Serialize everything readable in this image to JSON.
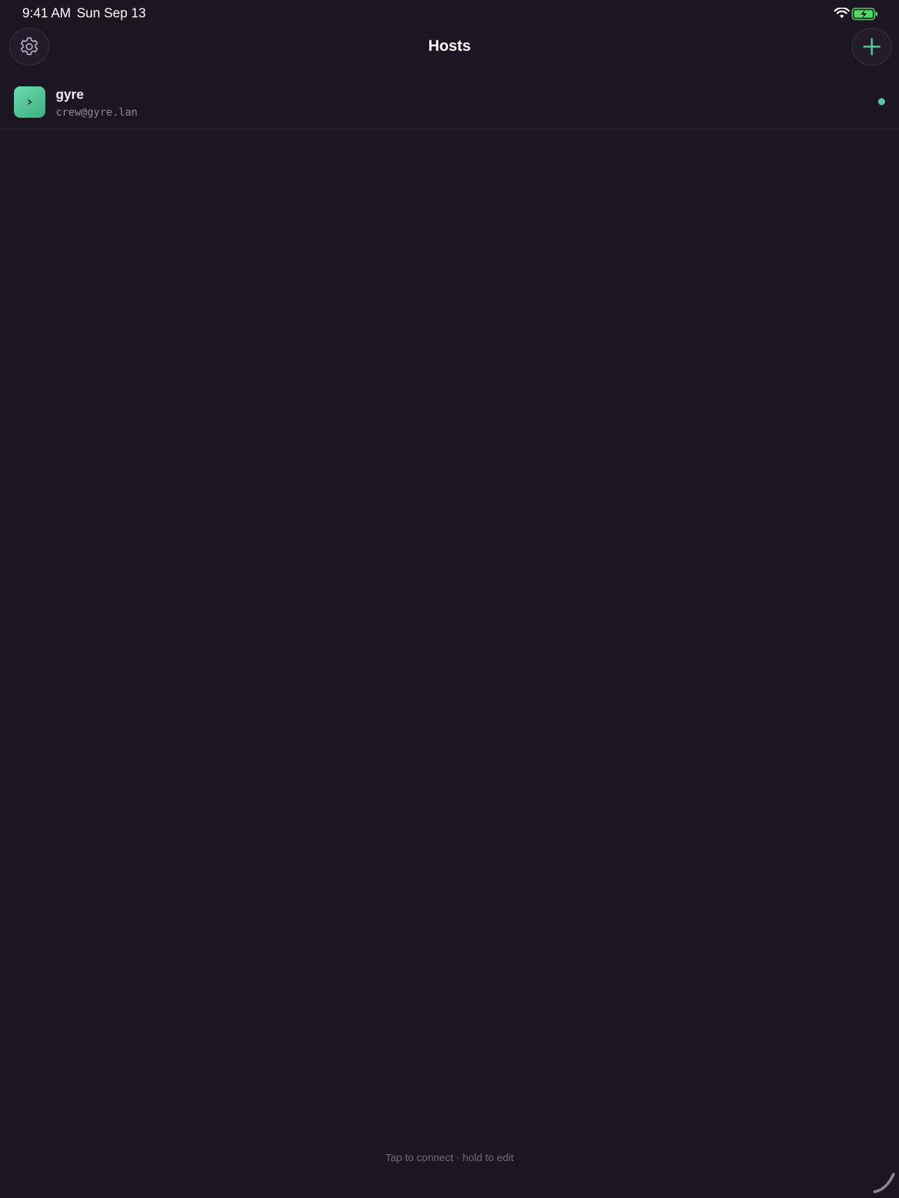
{
  "status_bar": {
    "time": "9:41 AM",
    "date": "Sun Sep 13",
    "icons": [
      "wifi-icon",
      "battery-charging-icon"
    ],
    "battery_color": "#4cd964"
  },
  "nav": {
    "title": "Hosts",
    "left_icon": "gear-icon",
    "right_icon": "plus-icon",
    "accent": "#55c99c"
  },
  "hosts": [
    {
      "name": "gyre",
      "address": "crew@gyre.lan",
      "avatar_glyph": "›",
      "status": "online",
      "status_color": "#55c99c"
    }
  ],
  "footer": {
    "hint": "Tap to connect · hold to edit"
  }
}
